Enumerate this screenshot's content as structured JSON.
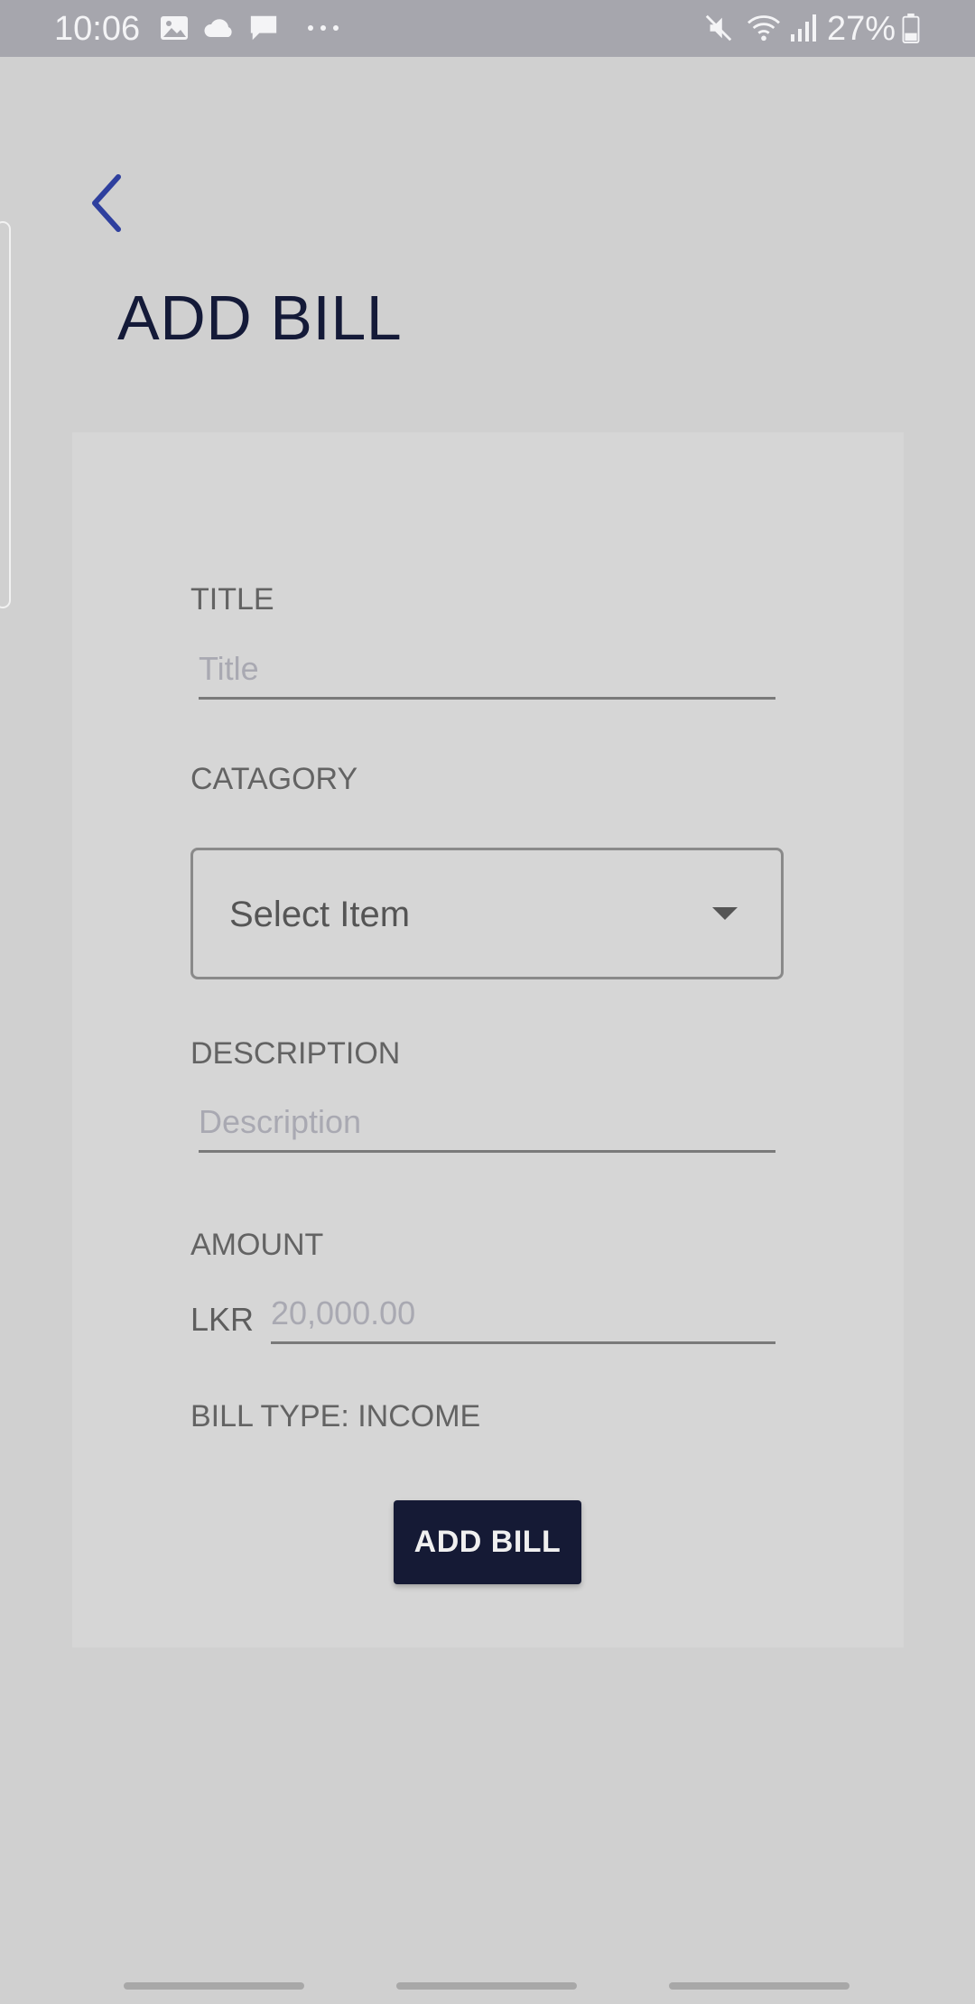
{
  "status_bar": {
    "time": "10:06",
    "battery": "27%",
    "icons": [
      "image-icon",
      "cloud-icon",
      "message-icon",
      "more-icon",
      "mute-icon",
      "wifi-icon",
      "signal-icon",
      "battery-icon"
    ]
  },
  "header": {
    "back_icon": "chevron-left-icon",
    "title": "ADD BILL"
  },
  "form": {
    "title_label": "TITLE",
    "title_placeholder": "Title",
    "title_value": "",
    "category_label": "CATAGORY",
    "category_selected": "Select Item",
    "description_label": "DESCRIPTION",
    "description_placeholder": "Description",
    "description_value": "",
    "amount_label": "AMOUNT",
    "currency": "LKR",
    "amount_placeholder": "20,000.00",
    "amount_value": "",
    "bill_type": "BILL TYPE: INCOME",
    "submit_label": "ADD BILL"
  },
  "colors": {
    "background": "#d0d0d0",
    "card": "#d6d6d6",
    "status_bar": "#a6a6ad",
    "accent_dark": "#151a35",
    "back_icon": "#2e3f9e"
  }
}
